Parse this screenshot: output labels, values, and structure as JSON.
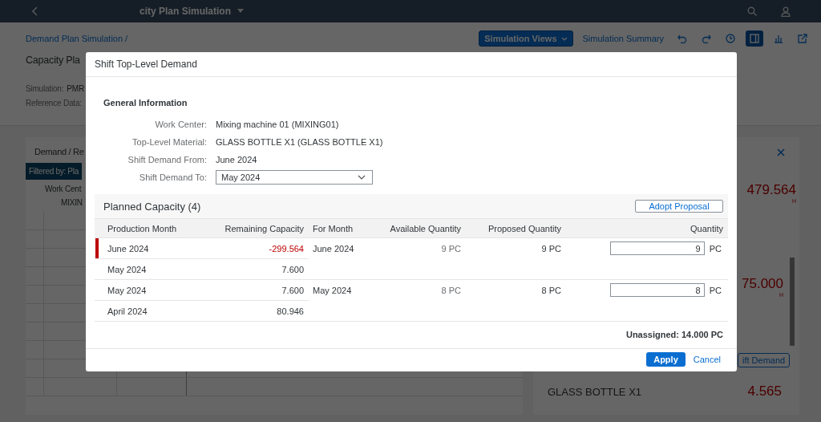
{
  "shell": {
    "title": "city Plan Simulation"
  },
  "header": {
    "breadcrumb": "Demand Plan Simulation /",
    "title": "Capacity Pla",
    "views_button": "Simulation Views",
    "summary_button": "Simulation Summary",
    "icon_buttons": [
      {
        "kind": "undo",
        "selected": false
      },
      {
        "kind": "redo",
        "selected": false
      },
      {
        "kind": "clock",
        "selected": false
      },
      {
        "kind": "panel",
        "selected": true
      },
      {
        "kind": "chart",
        "selected": false
      },
      {
        "kind": "share",
        "selected": false
      }
    ]
  },
  "info": [
    {
      "label": "Simulation:",
      "value": "PMR"
    },
    {
      "label": "Reference Data:"
    }
  ],
  "left_panel": {
    "title": "Demand / Re",
    "filter": "Filtered by: Pla",
    "column": "Work Cent",
    "cell": "MIXIN"
  },
  "right_panel": {
    "kpis": [
      {
        "value": "479.564",
        "unit": "H"
      },
      {
        "value": "75.000",
        "unit": "H"
      }
    ],
    "button": "ift Demand",
    "item": {
      "name": "GLASS BOTTLE X1",
      "value": "4.565"
    }
  },
  "dialog": {
    "title": "Shift Top-Level Demand",
    "section_title": "General Information",
    "fields": [
      {
        "label": "Work Center:",
        "value": "Mixing machine 01 (MIXING01)",
        "kind": "text"
      },
      {
        "label": "Top-Level Material:",
        "value": "GLASS BOTTLE X1 (GLASS BOTTLE X1)",
        "kind": "text"
      },
      {
        "label": "Shift Demand From:",
        "value": "June 2024",
        "kind": "text"
      },
      {
        "label": "Shift Demand To:",
        "value": "May 2024",
        "kind": "select"
      }
    ],
    "planned_capacity": {
      "title": "Planned Capacity (4)",
      "adopt_button": "Adopt Proposal",
      "columns": [
        "Production Month",
        "Remaining Capacity",
        "For Month",
        "Available Quantity",
        "Proposed Quantity",
        "Quantity"
      ],
      "groups": [
        {
          "rows": [
            {
              "production_month": "June 2024",
              "remaining_capacity": "-299.564",
              "negative": true,
              "alert": true
            },
            {
              "production_month": "May 2024",
              "remaining_capacity": "7.600",
              "negative": false,
              "alert": false
            }
          ],
          "for_month": "June 2024",
          "available": "9 PC",
          "proposed": "9 PC",
          "quantity": "9",
          "unit": "PC"
        },
        {
          "rows": [
            {
              "production_month": "May 2024",
              "remaining_capacity": "7.600",
              "negative": false,
              "alert": false
            },
            {
              "production_month": "April 2024",
              "remaining_capacity": "80.946",
              "negative": false,
              "alert": false
            }
          ],
          "for_month": "May 2024",
          "available": "8 PC",
          "proposed": "8 PC",
          "quantity": "8",
          "unit": "PC"
        }
      ],
      "unassigned": "Unassigned: 14.000 PC"
    },
    "apply_button": "Apply",
    "cancel_button": "Cancel"
  }
}
